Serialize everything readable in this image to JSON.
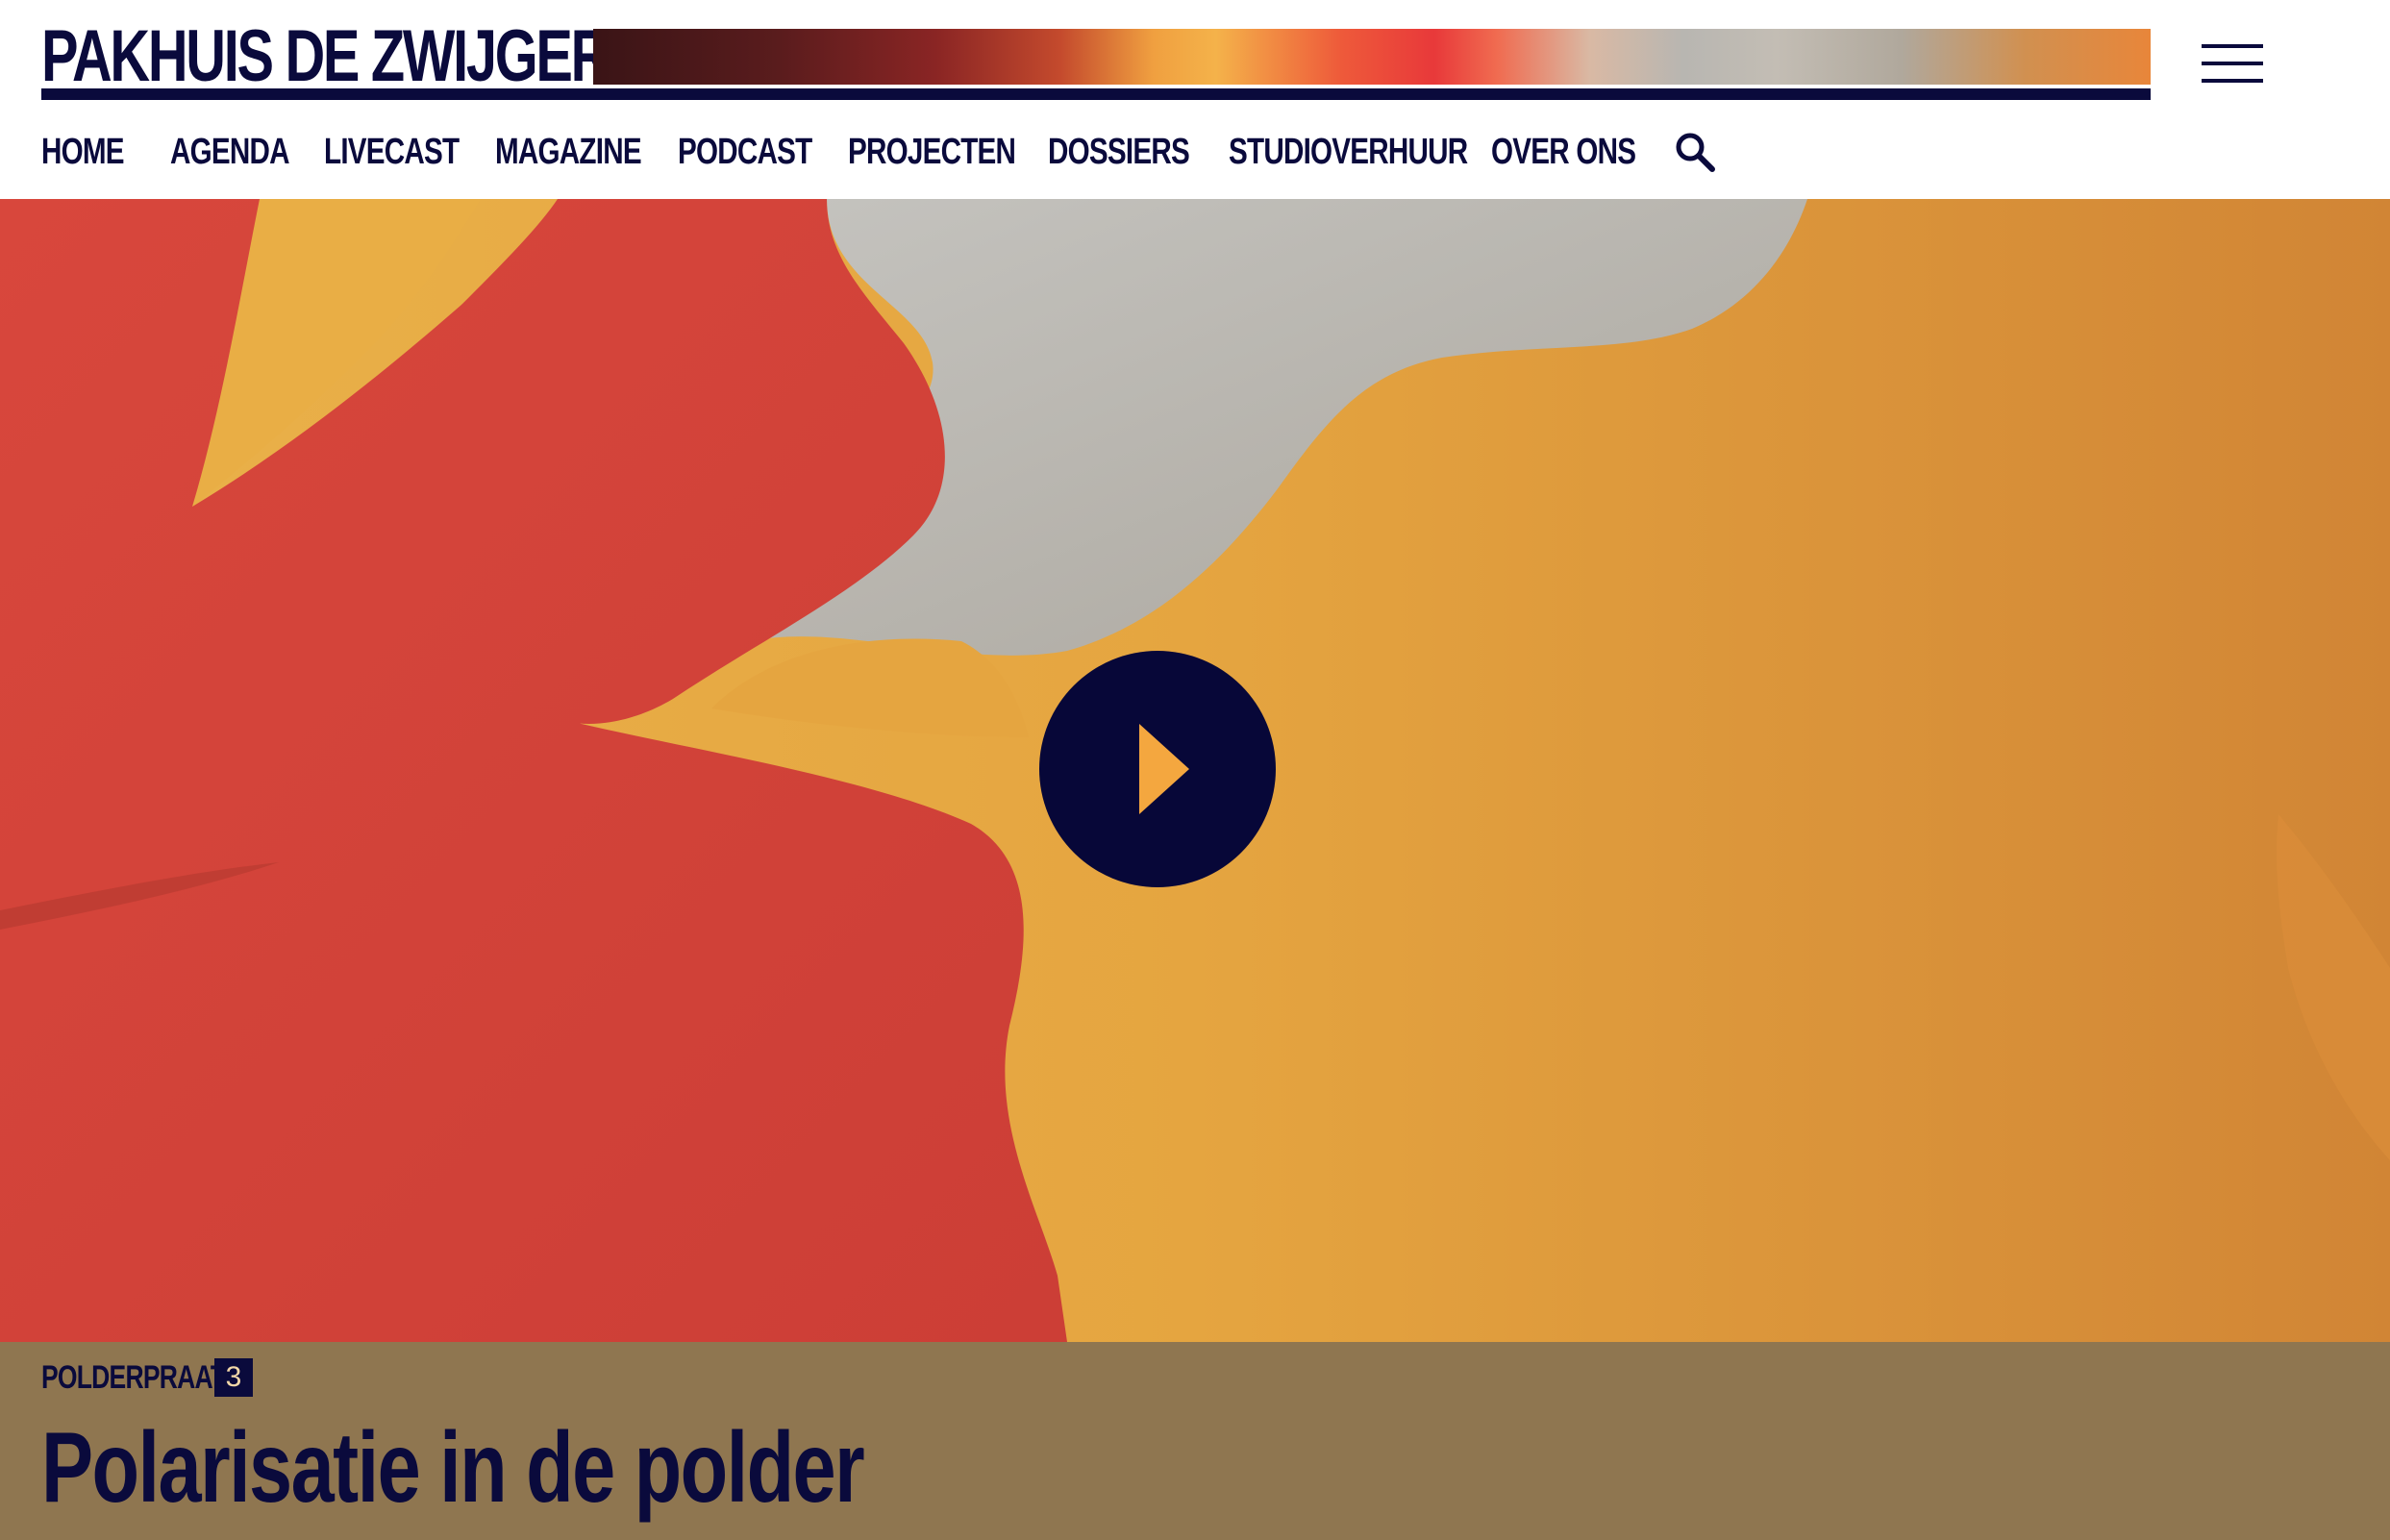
{
  "header": {
    "logo_text": "PAKHUIS DE ZWIJGER",
    "menu_icon": "hamburger-menu-icon",
    "search_icon": "search-icon"
  },
  "nav": {
    "items": [
      {
        "label": "HOME"
      },
      {
        "label": "AGENDA"
      },
      {
        "label": "LIVECAST"
      },
      {
        "label": "MAGAZINE"
      },
      {
        "label": "PODCAST"
      },
      {
        "label": "PROJECTEN"
      },
      {
        "label": "DOSSIERS"
      },
      {
        "label": "STUDIOVERHUUR"
      },
      {
        "label": "OVER ONS"
      }
    ]
  },
  "hero": {
    "play_icon": "play-icon"
  },
  "episode": {
    "series": "POLDERPRAAT",
    "episode_number": "3",
    "title": "Polarisatie in de polder"
  },
  "colors": {
    "navy": "#0a0a3c",
    "caption_band": "#8f7650",
    "hero_orange": "#e4a63f",
    "hero_red": "#d4433a",
    "hero_grey": "#c4c2bc"
  }
}
